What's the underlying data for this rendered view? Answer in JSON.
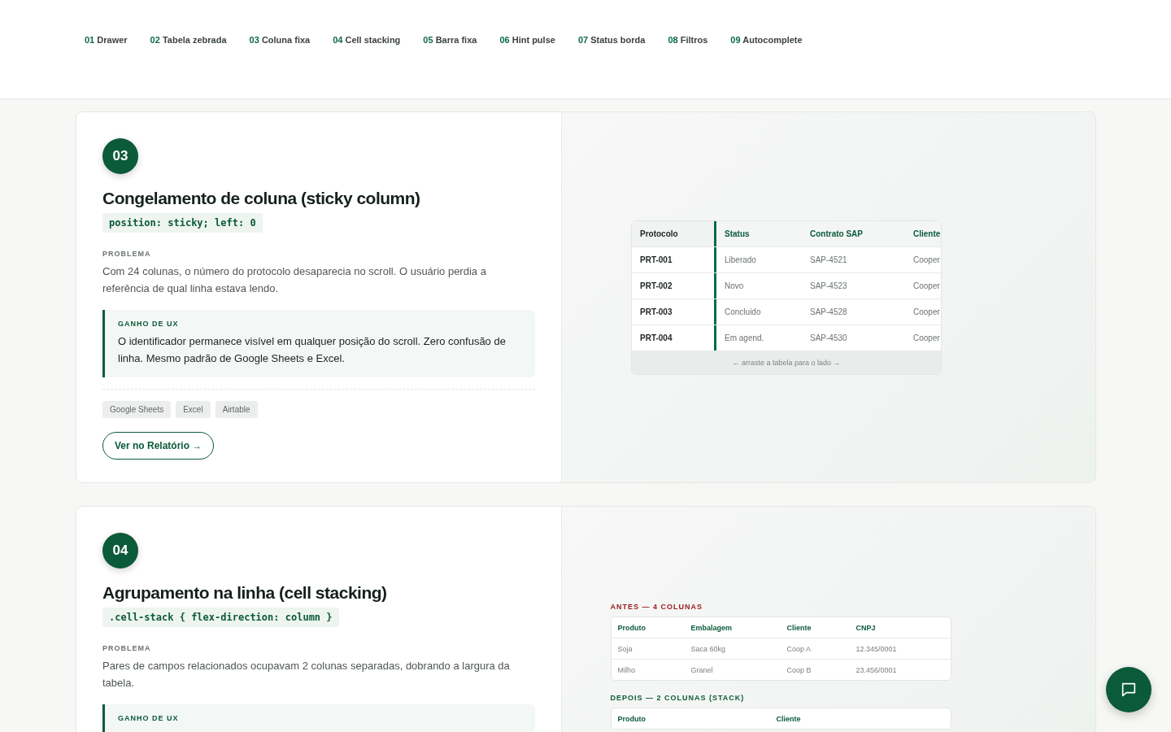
{
  "nav": [
    {
      "num": "01",
      "label": "Drawer"
    },
    {
      "num": "02",
      "label": "Tabela zebrada"
    },
    {
      "num": "03",
      "label": "Coluna fixa"
    },
    {
      "num": "04",
      "label": "Cell stacking"
    },
    {
      "num": "05",
      "label": "Barra fixa"
    },
    {
      "num": "06",
      "label": "Hint pulse"
    },
    {
      "num": "07",
      "label": "Status borda"
    },
    {
      "num": "08",
      "label": "Filtros"
    },
    {
      "num": "09",
      "label": "Autocomplete"
    }
  ],
  "sections": [
    {
      "number": "03",
      "title": "Congelamento de coluna (sticky column)",
      "code": "position: sticky; left: 0",
      "problem_label": "PROBLEMA",
      "problem": "Com 24 colunas, o número do protocolo desaparecia no scroll. O usuário perdia a referência de qual linha estava lendo.",
      "gain_label": "GANHO DE UX",
      "gain": "O identificador permanece visível em qualquer posição do scroll. Zero confusão de linha. Mesmo padrão de Google Sheets e Excel.",
      "tags": [
        "Google Sheets",
        "Excel",
        "Airtable"
      ],
      "button": "Ver no Relatório →",
      "demo": {
        "kind": "sticky",
        "columns": [
          "Protocolo",
          "Status",
          "Contrato SAP",
          "Cliente"
        ],
        "rows": [
          [
            "PRT-001",
            "Liberado",
            "SAP-4521",
            "Cooper"
          ],
          [
            "PRT-002",
            "Novo",
            "SAP-4523",
            "Cooper"
          ],
          [
            "PRT-003",
            "Concluido",
            "SAP-4528",
            "Cooper"
          ],
          [
            "PRT-004",
            "Em agend.",
            "SAP-4530",
            "Cooper"
          ]
        ],
        "hint": "← arraste a tabela para o lado →"
      }
    },
    {
      "number": "04",
      "title": "Agrupamento na linha (cell stacking)",
      "code": ".cell-stack { flex-direction: column }",
      "problem_label": "PROBLEMA",
      "problem": "Pares de campos relacionados ocupavam 2 colunas separadas, dobrando a largura da tabela.",
      "gain_label": "GANHO DE UX",
      "demo": {
        "kind": "stack",
        "before_label": "ANTES — 4 COLUNAS",
        "before_columns": [
          "Produto",
          "Embalagem",
          "Cliente",
          "CNPJ"
        ],
        "before_rows": [
          [
            "Soja",
            "Saca 60kg",
            "Coop A",
            "12.345/0001"
          ],
          [
            "Milho",
            "Granel",
            "Coop B",
            "23.456/0001"
          ]
        ],
        "after_label": "DEPOIS — 2 COLUNAS (STACK)",
        "after_columns": [
          "Produto",
          "Cliente"
        ]
      }
    }
  ]
}
